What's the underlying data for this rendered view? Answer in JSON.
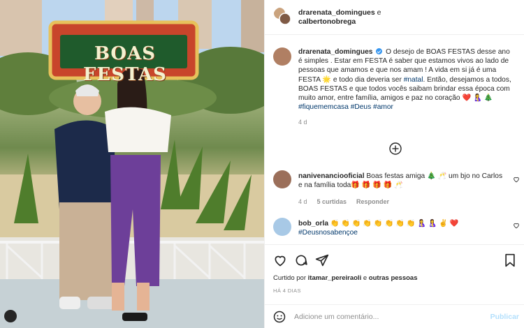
{
  "photo": {
    "sign_text": "BOAS FESTAS"
  },
  "header": {
    "user1": "drarenata_domingues",
    "and_word": "e",
    "user2": "calbertonobrega"
  },
  "caption": {
    "username": "drarenata_domingues",
    "text_1": "O desejo de BOAS FESTAS desse ano é simples . Estar em FESTA é saber que estamos vivos ao lado de pessoas que amamos e que nos amam ! A vida em si já é uma FESTA",
    "emoji_1": "🌟",
    "text_2": "e todo dia deveria ser",
    "hashtag_natal": "#natal",
    "text_3": ". Então, desejamos a todos, BOAS FESTAS e que todos vocês saibam brindar essa época com muito amor, entre família, amigos e paz no coração",
    "emoji_2": "❤️ 🤱 🎄",
    "hashtags": "#fiquememcasa #Deus #amor",
    "time": "4 d"
  },
  "load_more_icon": "plus-circle-icon",
  "comments": [
    {
      "username": "nanivenanciooficial",
      "text": "Boas festas amiga 🎄 🥂 um bjo no Carlos e na família toda🎁 🎁 🎁 🎁 🥂",
      "time": "4 d",
      "likes": "5 curtidas",
      "reply": "Responder"
    },
    {
      "username": "bob_orla",
      "text": "👏 👏 👏 👏 👏 👏 👏 👏 🤱 🤱 ✌️ ❤️",
      "hashtag": "#Deusnosabençoe"
    }
  ],
  "actions": {
    "like_icon": "heart-icon",
    "comment_icon": "comment-icon",
    "share_icon": "send-icon",
    "save_icon": "bookmark-icon"
  },
  "likes": {
    "prefix": "Curtido por",
    "user": "itamar_pereiraoli",
    "suffix": "e",
    "others": "outras pessoas"
  },
  "date": "HÁ 4 DIAS",
  "add_comment": {
    "placeholder": "Adicione um comentário...",
    "post_label": "Publicar",
    "emoji_icon": "smiley-icon"
  },
  "colors": {
    "accent_link": "#00376b",
    "verified": "#3897f0",
    "muted": "#8e8e8e",
    "publish_disabled": "#b2dffc"
  }
}
